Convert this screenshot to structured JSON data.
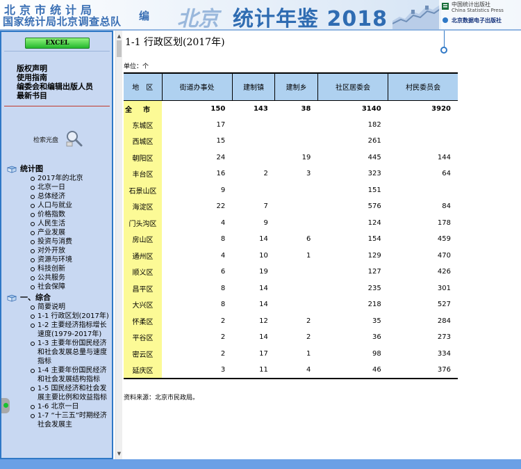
{
  "banner": {
    "org_line1": "北京市统计局",
    "org_line2": "国家统计局北京调查总队",
    "edit_label": "编",
    "beijing_text": "北京",
    "yearbook_title": "统计年鉴 2018",
    "publisher_cn": "中国统计出版社",
    "publisher_en": "China Statistics Press",
    "publisher_digital": "北京数据电子出版社"
  },
  "sidebar": {
    "excel_label": "EXCEL",
    "links": [
      "版权声明",
      "使用指南",
      "编委会和编辑出版人员",
      "最新书目"
    ],
    "search_label": "检索光盘",
    "categories": [
      {
        "label": "统计图",
        "items": [
          "2017年的北京",
          "北京一日",
          "总体经济",
          "人口与就业",
          "价格指数",
          "人民生活",
          "产业发展",
          "投资与消费",
          "对外开放",
          "资源与环境",
          "科技创新",
          "公共服务",
          "社会保障"
        ]
      },
      {
        "label": "一、综合",
        "items": [
          "简要说明",
          "1-1 行政区划(2017年)",
          "1-2 主要经济指标增长速度(1979-2017年)",
          "1-3 主要年份国民经济和社会发展总量与速度指标",
          "1-4 主要年份国民经济和社会发展结构指标",
          "1-5 国民经济和社会发展主要比例和效益指标",
          "1-6 北京一日",
          "1-7 “十三五”时期经济社会发展主"
        ]
      }
    ]
  },
  "main": {
    "title": "1-1  行政区划(2017年)",
    "unit": "单位：个",
    "source": "资料来源：北京市民政局。",
    "table": {
      "headers": [
        "地　区",
        "街道办事处",
        "建制镇",
        "建制乡",
        "社区居委会",
        "村民委员会"
      ],
      "rows": [
        [
          "全　市",
          "150",
          "143",
          "38",
          "3140",
          "3920"
        ],
        [
          "东城区",
          "17",
          "",
          "",
          "182",
          ""
        ],
        [
          "西城区",
          "15",
          "",
          "",
          "261",
          ""
        ],
        [
          "朝阳区",
          "24",
          "",
          "19",
          "445",
          "144"
        ],
        [
          "丰台区",
          "16",
          "2",
          "3",
          "323",
          "64"
        ],
        [
          "石景山区",
          "9",
          "",
          "",
          "151",
          ""
        ],
        [
          "海淀区",
          "22",
          "7",
          "",
          "576",
          "84"
        ],
        [
          "门头沟区",
          "4",
          "9",
          "",
          "124",
          "178"
        ],
        [
          "房山区",
          "8",
          "14",
          "6",
          "154",
          "459"
        ],
        [
          "通州区",
          "4",
          "10",
          "1",
          "129",
          "470"
        ],
        [
          "顺义区",
          "6",
          "19",
          "",
          "127",
          "426"
        ],
        [
          "昌平区",
          "8",
          "14",
          "",
          "235",
          "301"
        ],
        [
          "大兴区",
          "8",
          "14",
          "",
          "218",
          "527"
        ],
        [
          "怀柔区",
          "2",
          "12",
          "2",
          "35",
          "284"
        ],
        [
          "平谷区",
          "2",
          "14",
          "2",
          "36",
          "273"
        ],
        [
          "密云区",
          "2",
          "17",
          "1",
          "98",
          "334"
        ],
        [
          "延庆区",
          "3",
          "11",
          "4",
          "46",
          "376"
        ]
      ]
    }
  },
  "colors": {
    "accent": "#2f78c6",
    "sidebar_bg": "#c8d8f2",
    "header_cell": "#afd1f0",
    "region_cell": "#fcfa96",
    "excel_button": "#24b82d"
  },
  "icons": [
    "book-icon",
    "magnifier-icon",
    "great-wall-image",
    "press-logo-icon"
  ]
}
